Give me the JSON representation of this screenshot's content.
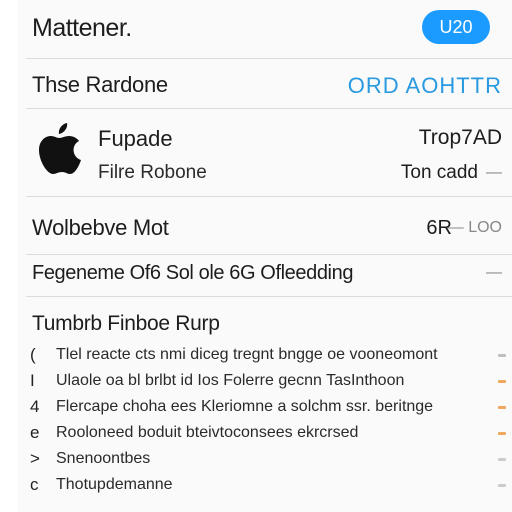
{
  "header": {
    "title": "Mattener.",
    "button_label": "U20"
  },
  "section1": {
    "title": "Thse Rardone",
    "link": "ORD AOHTTR"
  },
  "device": {
    "name": "Fupade",
    "subtitle": "Filre Robone",
    "right_top": "Trop7AD",
    "right_bottom": "Ton cadd",
    "chevron": "—"
  },
  "row_a": {
    "label": "Wolbebve Mot",
    "value": "6R",
    "unit": "— LOO"
  },
  "row_b": {
    "label": "Fegeneme Of6 Sol ole 6G Ofleedding",
    "value": "—"
  },
  "list": {
    "title": "Tumbrb Finboe Rurp",
    "items": [
      {
        "marker": "(",
        "text": "Tlel reacte cts nmi diceg tregnt bngge oe vooneomont",
        "accent": "#bfbfbf"
      },
      {
        "marker": "I",
        "text": "Ulaole oa bl brlbt id Ios Folerre gecnn TasInthoon",
        "accent": "#f0a860"
      },
      {
        "marker": "4",
        "text": "Flercape choha ees Kleriomne a solchm ssr. beritnge",
        "accent": "#f0a860"
      },
      {
        "marker": "e",
        "text": "Rooloneed boduit bteivtoconsees ekrcrsed",
        "accent": "#f0a860"
      },
      {
        "marker": ">",
        "text": "Snenoontbes",
        "accent": "#cccccc"
      },
      {
        "marker": "c",
        "text": "Thotupdemanne",
        "accent": "#cccccc"
      }
    ]
  },
  "colors": {
    "accent": "#1b9bff",
    "link": "#2a9ae0",
    "warning": "#f0a860"
  },
  "icons": {
    "device": "apple-logo-icon"
  }
}
